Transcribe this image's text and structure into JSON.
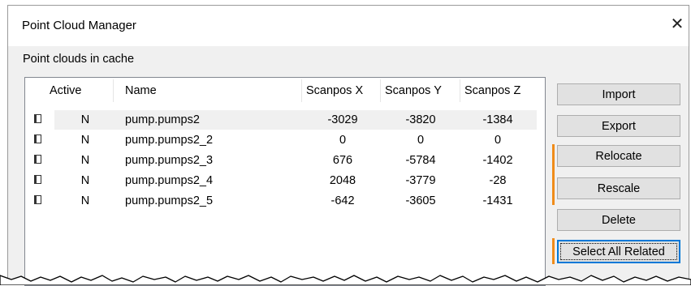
{
  "window": {
    "title": "Point Cloud Manager",
    "close_glyph": "✕"
  },
  "group_label": "Point clouds in cache",
  "table": {
    "headers": {
      "active": "Active",
      "name": "Name",
      "x": "Scanpos X",
      "y": "Scanpos Y",
      "z": "Scanpos Z"
    },
    "rows": [
      {
        "active": "N",
        "name": "pump.pumps2",
        "x": "-3029",
        "y": "-3820",
        "z": "-1384"
      },
      {
        "active": "N",
        "name": "pump.pumps2_2",
        "x": "0",
        "y": "0",
        "z": "0"
      },
      {
        "active": "N",
        "name": "pump.pumps2_3",
        "x": "676",
        "y": "-5784",
        "z": "-1402"
      },
      {
        "active": "N",
        "name": "pump.pumps2_4",
        "x": "2048",
        "y": "-3779",
        "z": "-28"
      },
      {
        "active": "N",
        "name": "pump.pumps2_5",
        "x": "-642",
        "y": "-3605",
        "z": "-1431"
      }
    ]
  },
  "buttons": {
    "import": "Import",
    "export": "Export",
    "relocate": "Relocate",
    "rescale": "Rescale",
    "delete": "Delete",
    "select_all_related": "Select All Related"
  },
  "colors": {
    "accent": "#f08c1a",
    "focus": "#0078d7"
  }
}
